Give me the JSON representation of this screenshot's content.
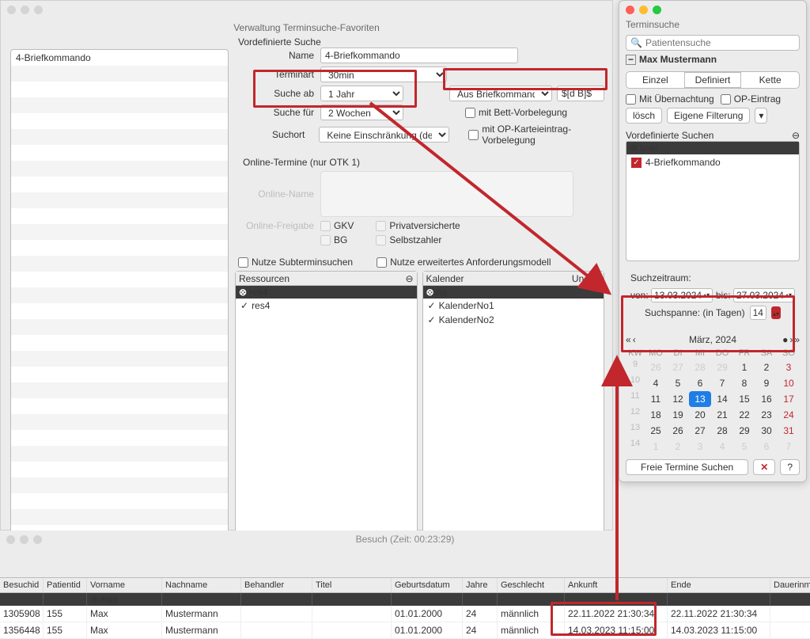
{
  "admin": {
    "title": "Verwaltung Terminsuche-Favoriten",
    "section_predef": "Vordefinierte Suche",
    "sidebar_item": "4-Briefkommando",
    "labels": {
      "name": "Name",
      "terminart": "Terminart",
      "suche_ab": "Suche ab",
      "suche_fuer": "Suche für",
      "suchort": "Suchort",
      "online_section": "Online-Termine (nur OTK 1)",
      "online_name": "Online-Name",
      "online_freigabe": "Online-Freigabe",
      "gkv": "GKV",
      "bg": "BG",
      "privat": "Privatversicherte",
      "selbst": "Selbstzahler",
      "nutze_sub": "Nutze Subterminsuchen",
      "nutze_erw": "Nutze erweitertes Anforderungsmodell",
      "ressourcen": "Ressourcen",
      "kalender": "Kalender",
      "und": "Und"
    },
    "values": {
      "name": "4-Briefkommando",
      "terminart": "30min",
      "suche_ab": "1 Jahr",
      "suche_fuer": "2 Wochen",
      "suchort": "Keine Einschränkung (default)",
      "brief_select": "Aus Briefkommando",
      "brief_macro": "$[d B]$",
      "chk_bett": "mit Bett-Vorbelegung",
      "chk_op": "mit OP-Karteieintrag-Vorbelegung"
    },
    "ressourcen_filter": "res4",
    "ressourcen_items": [
      "res4"
    ],
    "kalender_filter": "no",
    "kalender_items": [
      "KalenderNo1",
      "KalenderNo2"
    ]
  },
  "term": {
    "title": "Terminsuche",
    "search_ph": "Patientensuche",
    "patient": "Max Mustermann",
    "seg": {
      "einzel": "Einzel",
      "definiert": "Definiert",
      "kette": "Kette"
    },
    "chk_uebernacht": "Mit Übernachtung",
    "chk_op": "OP-Eintrag",
    "btn_loesch": "lösch",
    "btn_filter": "Eigene Filterung",
    "predef_title": "Vordefinierte Suchen",
    "predef_filter": "brief",
    "predef_item": "4-Briefkommando",
    "daterange": {
      "title": "Suchzeitraum:",
      "von_lbl": "von:",
      "von": "13.03.2024",
      "bis_lbl": "bis:",
      "bis": "27.03.2024",
      "span_lbl": "Suchspanne: (in Tagen)",
      "span": "14"
    },
    "cal": {
      "title": "März, 2024",
      "dow": [
        "KW",
        "MO",
        "DI",
        "MI",
        "DO",
        "FR",
        "SA",
        "SO"
      ],
      "rows": [
        {
          "kw": "9",
          "d": [
            "26",
            "27",
            "28",
            "29",
            "1",
            "2",
            "3"
          ],
          "other": [
            0,
            1,
            2,
            3
          ]
        },
        {
          "kw": "10",
          "d": [
            "4",
            "5",
            "6",
            "7",
            "8",
            "9",
            "10"
          ],
          "other": []
        },
        {
          "kw": "11",
          "d": [
            "11",
            "12",
            "13",
            "14",
            "15",
            "16",
            "17"
          ],
          "other": [],
          "today": 2
        },
        {
          "kw": "12",
          "d": [
            "18",
            "19",
            "20",
            "21",
            "22",
            "23",
            "24"
          ],
          "other": []
        },
        {
          "kw": "13",
          "d": [
            "25",
            "26",
            "27",
            "28",
            "29",
            "30",
            "31"
          ],
          "other": []
        },
        {
          "kw": "14",
          "d": [
            "1",
            "2",
            "3",
            "4",
            "5",
            "6",
            "7"
          ],
          "other": [
            0,
            1,
            2,
            3,
            4,
            5,
            6
          ]
        }
      ]
    },
    "btn_search": "Freie Termine Suchen"
  },
  "besuch": {
    "title": "Besuch  (Zeit: 00:23:29)",
    "cols": [
      "Besuchid",
      "Patientid",
      "Vorname",
      "Nachname",
      "Behandler",
      "Titel",
      "Geburtsdatum",
      "Jahre",
      "Geschlecht",
      "Ankunft",
      "Ende",
      "Dauerinmin"
    ],
    "filter_vorname": "max",
    "rows": [
      {
        "besuchid": "1305908",
        "patientid": "155",
        "vorname": "Max",
        "nachname": "Mustermann",
        "behandler": "",
        "titel": "",
        "geb": "01.01.2000",
        "jahre": "24",
        "geschl": "männlich",
        "ankunft": "22.11.2022 21:30:34",
        "ende": "22.11.2022 21:30:34"
      },
      {
        "besuchid": "1356448",
        "patientid": "155",
        "vorname": "Max",
        "nachname": "Mustermann",
        "behandler": "",
        "titel": "",
        "geb": "01.01.2000",
        "jahre": "24",
        "geschl": "männlich",
        "ankunft": "14.03.2023 11:15:00",
        "ende": "14.03.2023 11:15:00"
      }
    ]
  }
}
